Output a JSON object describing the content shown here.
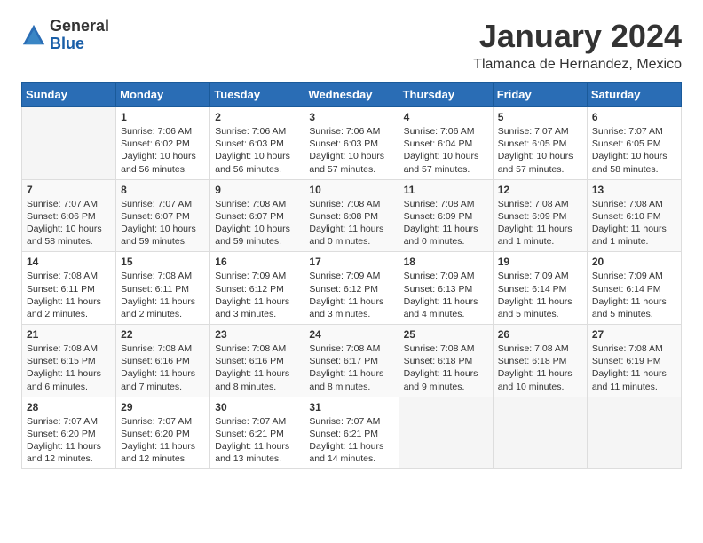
{
  "logo": {
    "general": "General",
    "blue": "Blue"
  },
  "title": "January 2024",
  "location": "Tlamanca de Hernandez, Mexico",
  "headers": [
    "Sunday",
    "Monday",
    "Tuesday",
    "Wednesday",
    "Thursday",
    "Friday",
    "Saturday"
  ],
  "weeks": [
    [
      {
        "day": "",
        "info": ""
      },
      {
        "day": "1",
        "info": "Sunrise: 7:06 AM\nSunset: 6:02 PM\nDaylight: 10 hours and 56 minutes."
      },
      {
        "day": "2",
        "info": "Sunrise: 7:06 AM\nSunset: 6:03 PM\nDaylight: 10 hours and 56 minutes."
      },
      {
        "day": "3",
        "info": "Sunrise: 7:06 AM\nSunset: 6:03 PM\nDaylight: 10 hours and 57 minutes."
      },
      {
        "day": "4",
        "info": "Sunrise: 7:06 AM\nSunset: 6:04 PM\nDaylight: 10 hours and 57 minutes."
      },
      {
        "day": "5",
        "info": "Sunrise: 7:07 AM\nSunset: 6:05 PM\nDaylight: 10 hours and 57 minutes."
      },
      {
        "day": "6",
        "info": "Sunrise: 7:07 AM\nSunset: 6:05 PM\nDaylight: 10 hours and 58 minutes."
      }
    ],
    [
      {
        "day": "7",
        "info": "Sunrise: 7:07 AM\nSunset: 6:06 PM\nDaylight: 10 hours and 58 minutes."
      },
      {
        "day": "8",
        "info": "Sunrise: 7:07 AM\nSunset: 6:07 PM\nDaylight: 10 hours and 59 minutes."
      },
      {
        "day": "9",
        "info": "Sunrise: 7:08 AM\nSunset: 6:07 PM\nDaylight: 10 hours and 59 minutes."
      },
      {
        "day": "10",
        "info": "Sunrise: 7:08 AM\nSunset: 6:08 PM\nDaylight: 11 hours and 0 minutes."
      },
      {
        "day": "11",
        "info": "Sunrise: 7:08 AM\nSunset: 6:09 PM\nDaylight: 11 hours and 0 minutes."
      },
      {
        "day": "12",
        "info": "Sunrise: 7:08 AM\nSunset: 6:09 PM\nDaylight: 11 hours and 1 minute."
      },
      {
        "day": "13",
        "info": "Sunrise: 7:08 AM\nSunset: 6:10 PM\nDaylight: 11 hours and 1 minute."
      }
    ],
    [
      {
        "day": "14",
        "info": "Sunrise: 7:08 AM\nSunset: 6:11 PM\nDaylight: 11 hours and 2 minutes."
      },
      {
        "day": "15",
        "info": "Sunrise: 7:08 AM\nSunset: 6:11 PM\nDaylight: 11 hours and 2 minutes."
      },
      {
        "day": "16",
        "info": "Sunrise: 7:09 AM\nSunset: 6:12 PM\nDaylight: 11 hours and 3 minutes."
      },
      {
        "day": "17",
        "info": "Sunrise: 7:09 AM\nSunset: 6:12 PM\nDaylight: 11 hours and 3 minutes."
      },
      {
        "day": "18",
        "info": "Sunrise: 7:09 AM\nSunset: 6:13 PM\nDaylight: 11 hours and 4 minutes."
      },
      {
        "day": "19",
        "info": "Sunrise: 7:09 AM\nSunset: 6:14 PM\nDaylight: 11 hours and 5 minutes."
      },
      {
        "day": "20",
        "info": "Sunrise: 7:09 AM\nSunset: 6:14 PM\nDaylight: 11 hours and 5 minutes."
      }
    ],
    [
      {
        "day": "21",
        "info": "Sunrise: 7:08 AM\nSunset: 6:15 PM\nDaylight: 11 hours and 6 minutes."
      },
      {
        "day": "22",
        "info": "Sunrise: 7:08 AM\nSunset: 6:16 PM\nDaylight: 11 hours and 7 minutes."
      },
      {
        "day": "23",
        "info": "Sunrise: 7:08 AM\nSunset: 6:16 PM\nDaylight: 11 hours and 8 minutes."
      },
      {
        "day": "24",
        "info": "Sunrise: 7:08 AM\nSunset: 6:17 PM\nDaylight: 11 hours and 8 minutes."
      },
      {
        "day": "25",
        "info": "Sunrise: 7:08 AM\nSunset: 6:18 PM\nDaylight: 11 hours and 9 minutes."
      },
      {
        "day": "26",
        "info": "Sunrise: 7:08 AM\nSunset: 6:18 PM\nDaylight: 11 hours and 10 minutes."
      },
      {
        "day": "27",
        "info": "Sunrise: 7:08 AM\nSunset: 6:19 PM\nDaylight: 11 hours and 11 minutes."
      }
    ],
    [
      {
        "day": "28",
        "info": "Sunrise: 7:07 AM\nSunset: 6:20 PM\nDaylight: 11 hours and 12 minutes."
      },
      {
        "day": "29",
        "info": "Sunrise: 7:07 AM\nSunset: 6:20 PM\nDaylight: 11 hours and 12 minutes."
      },
      {
        "day": "30",
        "info": "Sunrise: 7:07 AM\nSunset: 6:21 PM\nDaylight: 11 hours and 13 minutes."
      },
      {
        "day": "31",
        "info": "Sunrise: 7:07 AM\nSunset: 6:21 PM\nDaylight: 11 hours and 14 minutes."
      },
      {
        "day": "",
        "info": ""
      },
      {
        "day": "",
        "info": ""
      },
      {
        "day": "",
        "info": ""
      }
    ]
  ]
}
